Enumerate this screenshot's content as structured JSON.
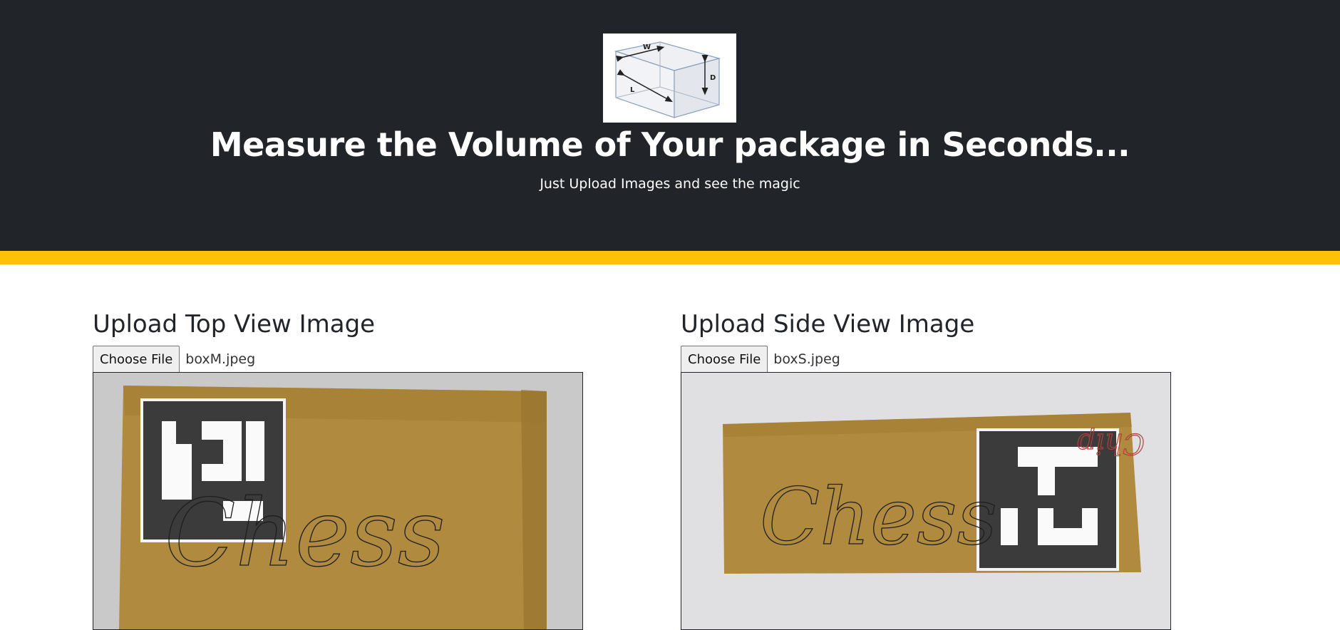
{
  "header": {
    "title": "Measure the Volume of Your package in Seconds...",
    "subtitle": "Just Upload Images and see the magic",
    "logo_labels": {
      "width": "W",
      "length": "L",
      "depth": "D"
    },
    "background_color": "#212529",
    "accent_color": "#ffc107"
  },
  "uploads": [
    {
      "heading": "Upload Top View Image",
      "button_label": "Choose File",
      "file_name": "boxM.jpeg",
      "handwriting": "Chess"
    },
    {
      "heading": "Upload Side View Image",
      "button_label": "Choose File",
      "file_name": "boxS.jpeg",
      "handwriting": "Chess"
    }
  ]
}
